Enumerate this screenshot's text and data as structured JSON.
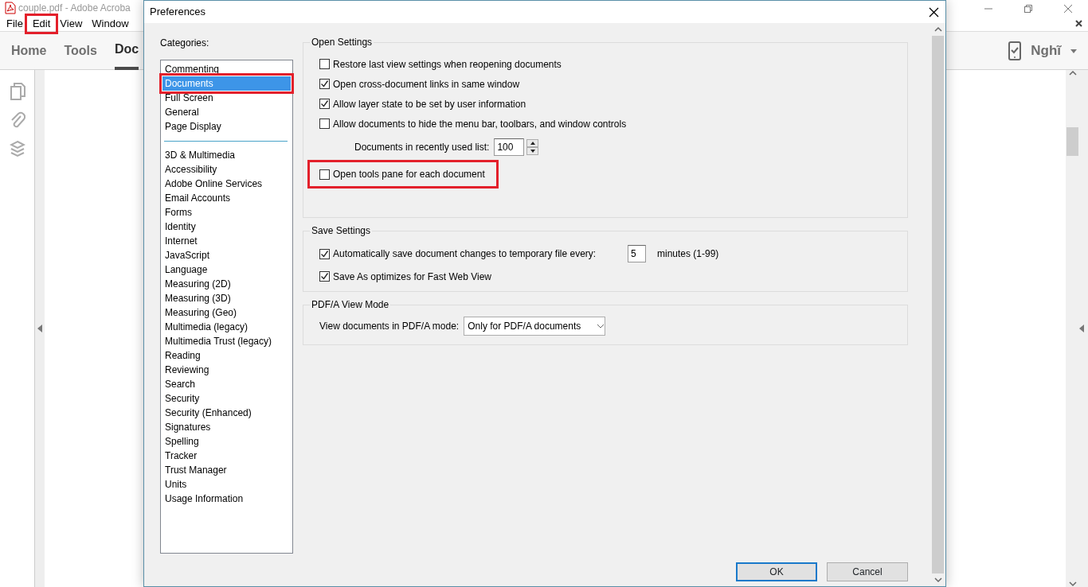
{
  "app": {
    "title": "couple.pdf - Adobe Acroba",
    "menu": [
      {
        "label": "File",
        "highlighted": false
      },
      {
        "label": "Edit",
        "highlighted": true
      },
      {
        "label": "View",
        "highlighted": false
      },
      {
        "label": "Window",
        "highlighted": false
      }
    ],
    "tabs": [
      {
        "label": "Home",
        "selected": false
      },
      {
        "label": "Tools",
        "selected": false
      },
      {
        "label": "Doc",
        "selected": true
      }
    ],
    "account": "Nghĩ"
  },
  "dialog": {
    "title": "Preferences",
    "categories_label": "Categories:",
    "category_groups": [
      [
        {
          "label": "Commenting",
          "selected": false,
          "highlighted": false
        },
        {
          "label": "Documents",
          "selected": true,
          "highlighted": true
        },
        {
          "label": "Full Screen",
          "selected": false,
          "highlighted": false
        },
        {
          "label": "General",
          "selected": false,
          "highlighted": false
        },
        {
          "label": "Page Display",
          "selected": false,
          "highlighted": false
        }
      ],
      [
        {
          "label": "3D & Multimedia",
          "selected": false,
          "highlighted": false
        },
        {
          "label": "Accessibility",
          "selected": false,
          "highlighted": false
        },
        {
          "label": "Adobe Online Services",
          "selected": false,
          "highlighted": false
        },
        {
          "label": "Email Accounts",
          "selected": false,
          "highlighted": false
        },
        {
          "label": "Forms",
          "selected": false,
          "highlighted": false
        },
        {
          "label": "Identity",
          "selected": false,
          "highlighted": false
        },
        {
          "label": "Internet",
          "selected": false,
          "highlighted": false
        },
        {
          "label": "JavaScript",
          "selected": false,
          "highlighted": false
        },
        {
          "label": "Language",
          "selected": false,
          "highlighted": false
        },
        {
          "label": "Measuring (2D)",
          "selected": false,
          "highlighted": false
        },
        {
          "label": "Measuring (3D)",
          "selected": false,
          "highlighted": false
        },
        {
          "label": "Measuring (Geo)",
          "selected": false,
          "highlighted": false
        },
        {
          "label": "Multimedia (legacy)",
          "selected": false,
          "highlighted": false
        },
        {
          "label": "Multimedia Trust (legacy)",
          "selected": false,
          "highlighted": false
        },
        {
          "label": "Reading",
          "selected": false,
          "highlighted": false
        },
        {
          "label": "Reviewing",
          "selected": false,
          "highlighted": false
        },
        {
          "label": "Search",
          "selected": false,
          "highlighted": false
        },
        {
          "label": "Security",
          "selected": false,
          "highlighted": false
        },
        {
          "label": "Security (Enhanced)",
          "selected": false,
          "highlighted": false
        },
        {
          "label": "Signatures",
          "selected": false,
          "highlighted": false
        },
        {
          "label": "Spelling",
          "selected": false,
          "highlighted": false
        },
        {
          "label": "Tracker",
          "selected": false,
          "highlighted": false
        },
        {
          "label": "Trust Manager",
          "selected": false,
          "highlighted": false
        },
        {
          "label": "Units",
          "selected": false,
          "highlighted": false
        },
        {
          "label": "Usage Information",
          "selected": false,
          "highlighted": false
        }
      ]
    ],
    "sections": [
      {
        "title": "Open Settings",
        "rows": [
          {
            "kind": "checkbox",
            "label": "Restore last view settings when reopening documents",
            "checked": false,
            "highlighted": false
          },
          {
            "kind": "checkbox",
            "label": "Open cross-document links in same window",
            "checked": true,
            "highlighted": false
          },
          {
            "kind": "checkbox",
            "label": "Allow layer state to be set by user information",
            "checked": true,
            "highlighted": false
          },
          {
            "kind": "checkbox",
            "label": "Allow documents to hide the menu bar, toolbars, and window controls",
            "checked": false,
            "highlighted": false
          },
          {
            "kind": "spinner",
            "label": "Documents in recently used list:",
            "value": "100"
          },
          {
            "kind": "checkbox",
            "label": "Open tools pane for each document",
            "checked": false,
            "highlighted": true
          }
        ]
      },
      {
        "title": "Save Settings",
        "rows": [
          {
            "kind": "checkbox_input",
            "label": "Automatically save document changes to temporary file every:",
            "checked": true,
            "value": "5",
            "suffix": "minutes (1-99)"
          },
          {
            "kind": "checkbox",
            "label": "Save As optimizes for Fast Web View",
            "checked": true,
            "highlighted": false
          }
        ]
      },
      {
        "title": "PDF/A View Mode",
        "rows": [
          {
            "kind": "select",
            "label": "View documents in PDF/A mode:",
            "value": "Only for PDF/A documents"
          }
        ]
      }
    ],
    "buttons": [
      {
        "label": "OK",
        "default": true
      },
      {
        "label": "Cancel",
        "default": false
      }
    ]
  }
}
